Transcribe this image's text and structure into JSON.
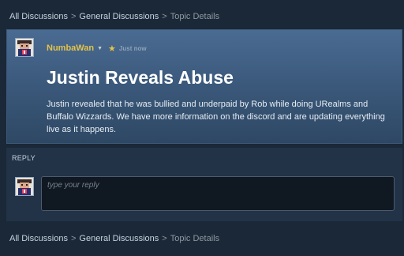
{
  "breadcrumb": {
    "items": [
      "All Discussions",
      "General Discussions",
      "Topic Details"
    ],
    "separator": ">"
  },
  "topic": {
    "author": "NumbaWan",
    "timestamp": "Just now",
    "title": "Justin Reveals Abuse",
    "body": "Justin revealed that he was bullied and underpaid by Rob while doing URealms and Buffalo Wizzards. We have more information on the discord and are updating everything live as it happens."
  },
  "reply": {
    "label": "REPLY",
    "placeholder": "type your reply"
  },
  "icons": {
    "author_menu": "chevron-down-icon",
    "author_badge": "star-icon"
  },
  "colors": {
    "page_background": "#1b2838",
    "topic_panel": "#3c5a7d",
    "author_name": "#e3c34a",
    "reply_section": "#223347"
  }
}
